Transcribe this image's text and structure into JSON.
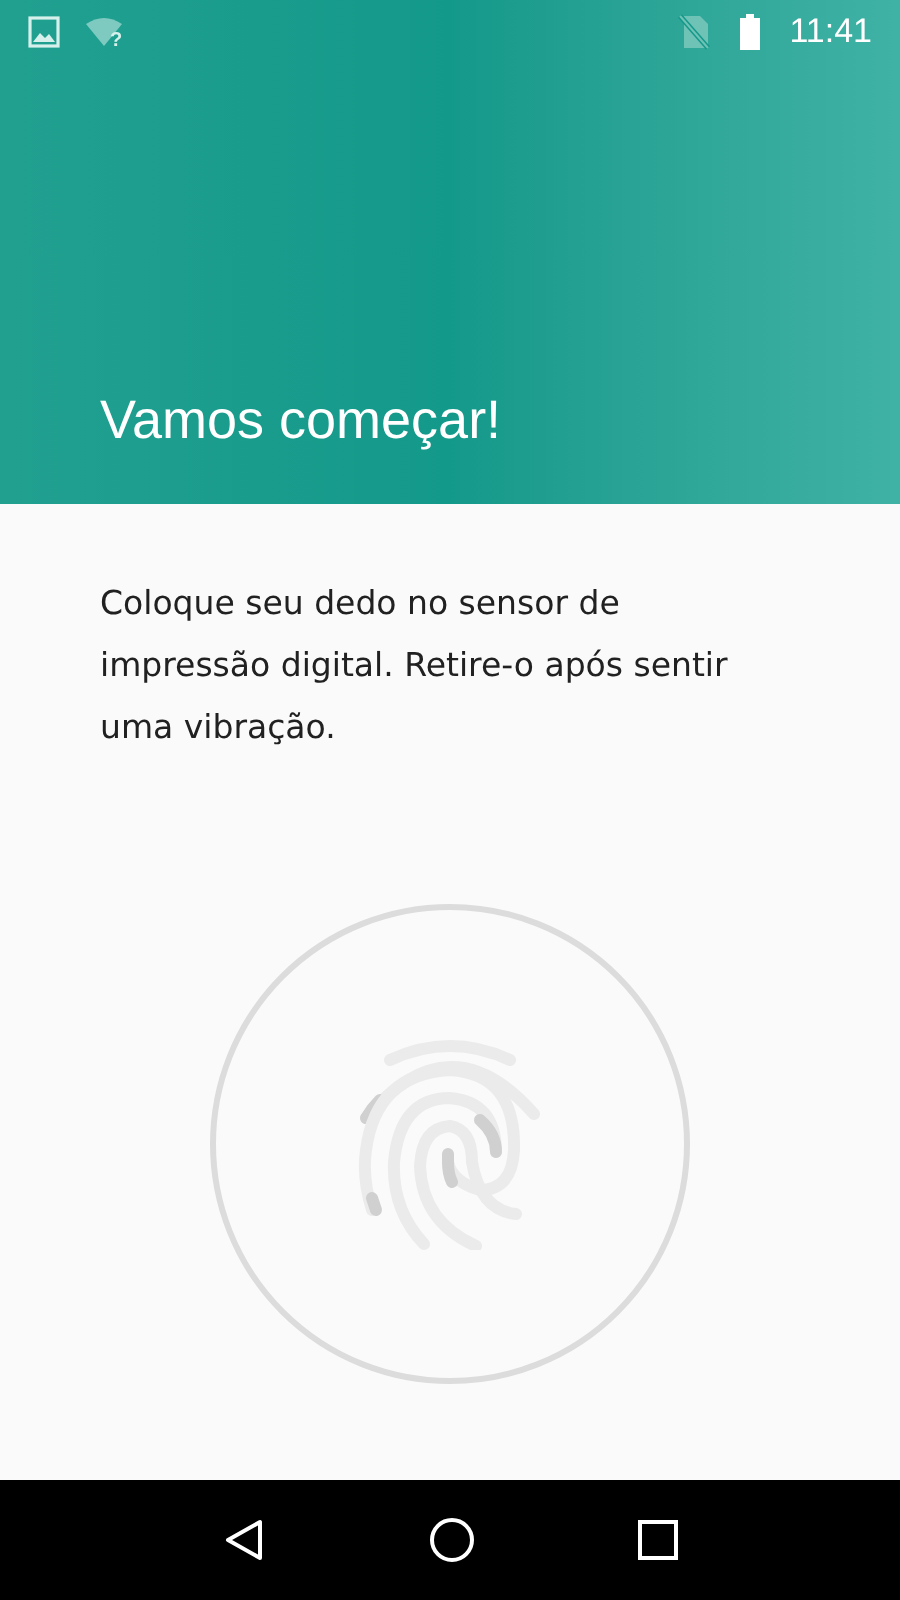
{
  "status_bar": {
    "wifi_badge": "?",
    "time": "11:41"
  },
  "header": {
    "title": "Vamos começar!"
  },
  "instructions": "Coloque seu dedo no sensor de impressão digital. Retire-o após sentir uma vibração."
}
